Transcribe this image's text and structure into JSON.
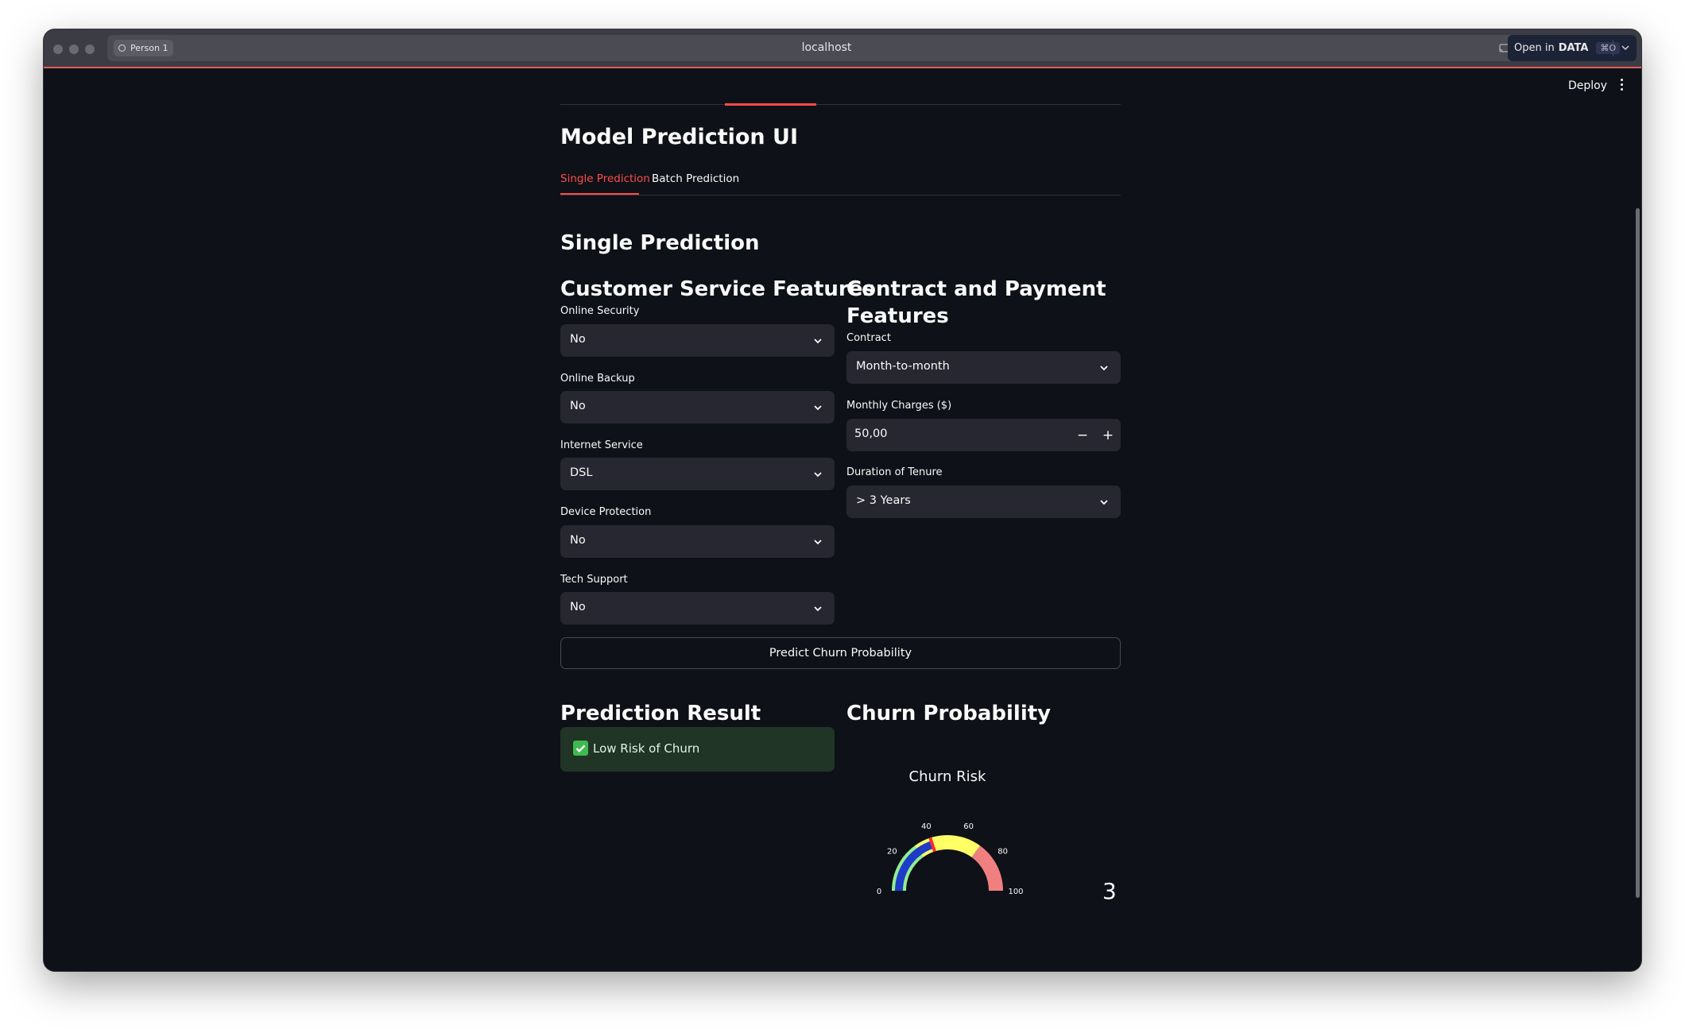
{
  "browser": {
    "profile": "Person 1",
    "url": "localhost",
    "open_in_label": "Open in",
    "open_in_app": "DATA",
    "open_in_shortcut": "⌘O"
  },
  "header": {
    "deploy_label": "Deploy"
  },
  "page": {
    "title": "Model Prediction UI",
    "tabs": [
      {
        "label": "Single Prediction",
        "active": true
      },
      {
        "label": "Batch Prediction",
        "active": false
      }
    ],
    "section_title": "Single Prediction"
  },
  "customer_service": {
    "title": "Customer Service Features",
    "fields": [
      {
        "label": "Online Security",
        "value": "No"
      },
      {
        "label": "Online Backup",
        "value": "No"
      },
      {
        "label": "Internet Service",
        "value": "DSL"
      },
      {
        "label": "Device Protection",
        "value": "No"
      },
      {
        "label": "Tech Support",
        "value": "No"
      }
    ]
  },
  "contract": {
    "title_line1": "Contract and Payment",
    "title_line2": "Features",
    "contract_label": "Contract",
    "contract_value": "Month-to-month",
    "charges_label": "Monthly Charges ($)",
    "charges_value": "50,00",
    "minus": "−",
    "plus": "+",
    "tenure_label": "Duration of Tenure",
    "tenure_value": "> 3 Years"
  },
  "actions": {
    "predict_label": "Predict Churn Probability"
  },
  "result": {
    "title": "Prediction Result",
    "message": "Low Risk of Churn",
    "status_color": "#213527"
  },
  "churn": {
    "title": "Churn Probability",
    "gauge_title": "Churn Risk",
    "ticks": [
      "0",
      "20",
      "40",
      "60",
      "80",
      "100"
    ],
    "value_display": "3",
    "value": 3,
    "bands": [
      {
        "from": 0,
        "to": 30,
        "color": "#90ee90"
      },
      {
        "from": 30,
        "to": 70,
        "color": "#ffff66"
      },
      {
        "from": 70,
        "to": 100,
        "color": "#f08080"
      }
    ],
    "bar_color": "#1f3cc8"
  },
  "colors": {
    "accent": "#ff4b4b",
    "background": "#0e1117",
    "input": "#262730"
  }
}
